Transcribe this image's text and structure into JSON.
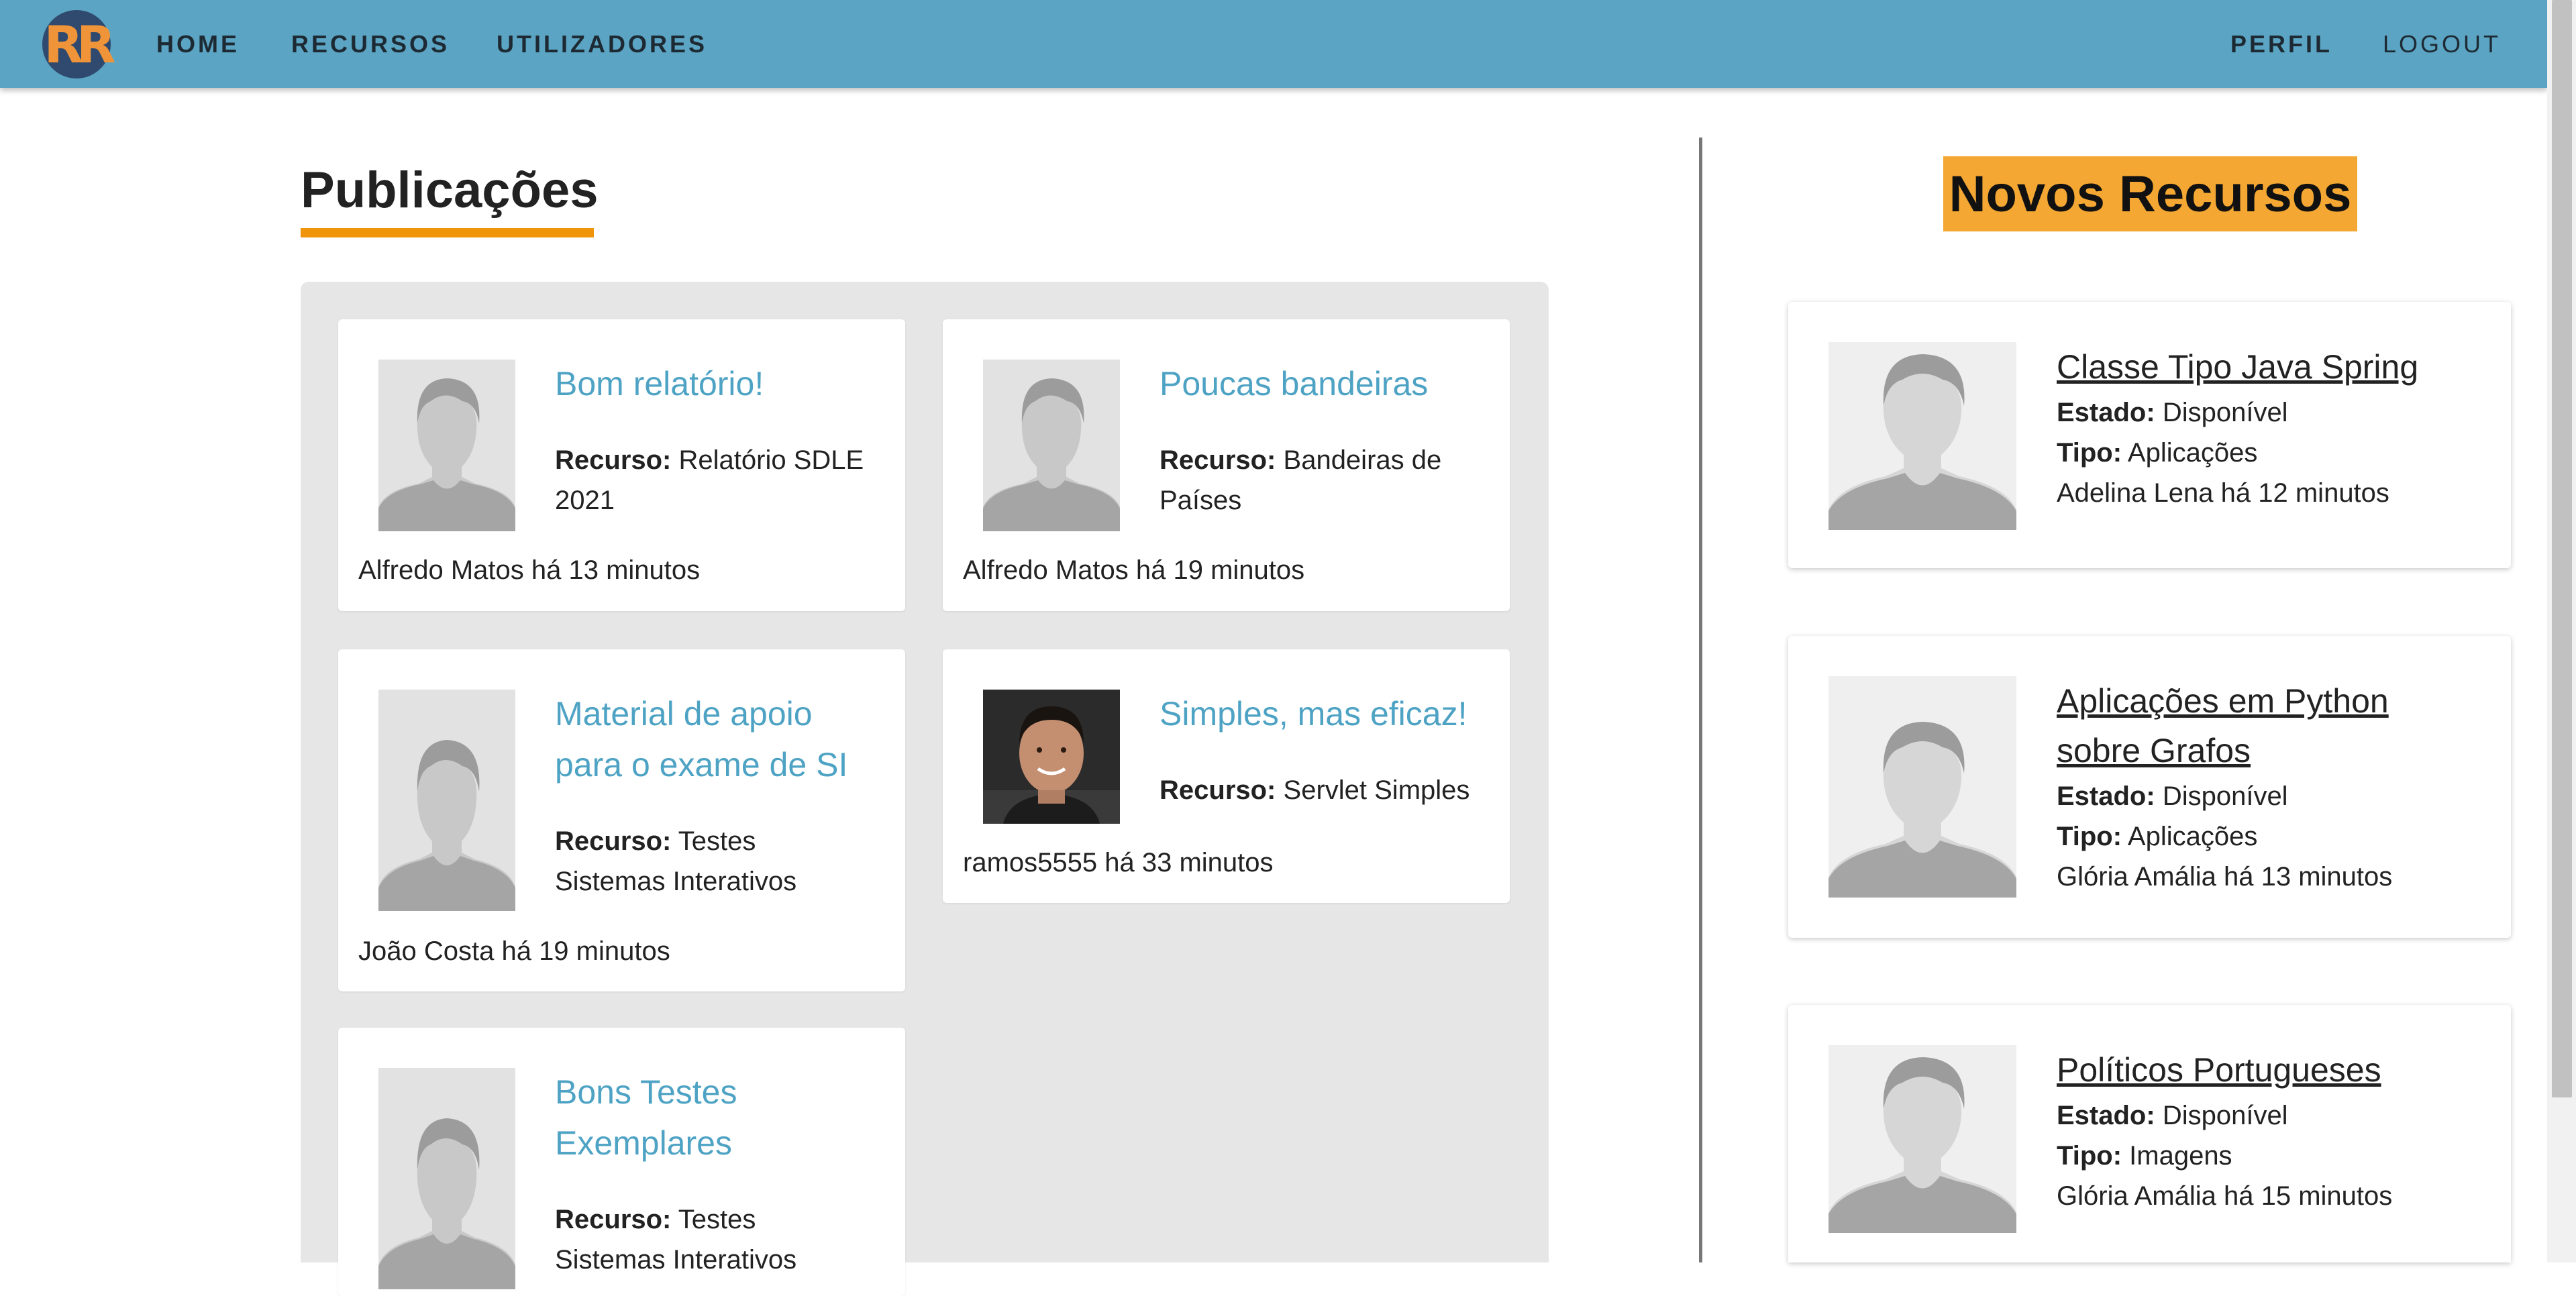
{
  "nav": {
    "logo_text": "RR",
    "links": [
      "HOME",
      "RECURSOS",
      "UTILIZADORES"
    ],
    "right": [
      "PERFIL",
      "LOGOUT"
    ]
  },
  "publicacoes": {
    "title": "Publicações",
    "resource_label": "Recurso:",
    "posts": [
      {
        "title_lines": [
          "Bom relatório!"
        ],
        "resource_lines": [
          "Relatório SDLE",
          "2021"
        ],
        "author": "Alfredo Matos há 13 minutos",
        "avatar": "default-avatar-icon"
      },
      {
        "title_lines": [
          "Poucas bandeiras"
        ],
        "resource_lines": [
          "Bandeiras de",
          "Países"
        ],
        "author": "Alfredo Matos há 19 minutos",
        "avatar": "default-avatar-icon"
      },
      {
        "title_lines": [
          "Material de apoio",
          "para o exame de SI"
        ],
        "resource_lines": [
          "Testes",
          "Sistemas Interativos"
        ],
        "author": "João Costa há 19 minutos",
        "avatar": "default-avatar-icon"
      },
      {
        "title_lines": [
          "Simples, mas eficaz!"
        ],
        "resource_lines": [
          "Servlet Simples"
        ],
        "author": "ramos5555 há 33 minutos",
        "avatar": "user-photo"
      },
      {
        "title_lines": [
          "Bons Testes",
          "Exemplares"
        ],
        "resource_lines": [
          "Testes",
          "Sistemas Interativos"
        ],
        "author": "",
        "avatar": "default-avatar-icon"
      }
    ]
  },
  "novos": {
    "title": "Novos Recursos",
    "estado_label": "Estado:",
    "tipo_label": "Tipo:",
    "items": [
      {
        "name_lines": [
          "Classe Tipo Java Spring"
        ],
        "estado": "Disponível",
        "tipo": "Aplicações",
        "author": "Adelina Lena há 12 minutos"
      },
      {
        "name_lines": [
          "Aplicações em Python",
          "sobre Grafos"
        ],
        "estado": "Disponível",
        "tipo": "Aplicações",
        "author": "Glória Amália há 13 minutos"
      },
      {
        "name_lines": [
          "Políticos Portugueses"
        ],
        "estado": "Disponível",
        "tipo": "Imagens",
        "author": "Glória Amália há 15 minutos"
      }
    ]
  },
  "colors": {
    "navbar": "#5ba4c3",
    "accent_orange": "#f0940a",
    "link_blue": "#4ea3c4",
    "panel_gray": "#e6e6e6"
  }
}
